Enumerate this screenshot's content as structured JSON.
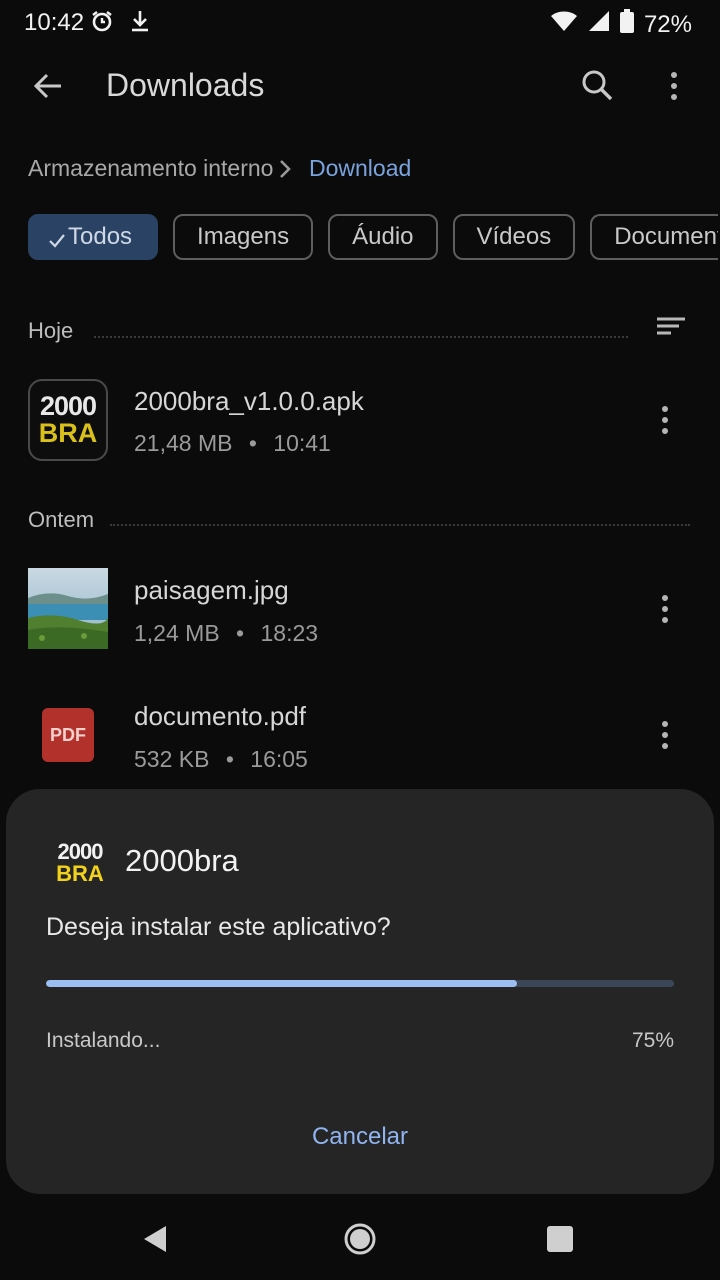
{
  "status": {
    "time": "10:42",
    "battery": "72%"
  },
  "appbar": {
    "title": "Downloads"
  },
  "breadcrumb": {
    "root": "Armazenamento interno",
    "current": "Download"
  },
  "chips": [
    {
      "label": "Todos",
      "selected": true
    },
    {
      "label": "Imagens",
      "selected": false
    },
    {
      "label": "Áudio",
      "selected": false
    },
    {
      "label": "Vídeos",
      "selected": false
    },
    {
      "label": "Document",
      "selected": false
    }
  ],
  "sections": [
    {
      "label": "Hoje"
    },
    {
      "label": "Ontem"
    }
  ],
  "files": [
    {
      "name": "2000bra_v1.0.0.apk",
      "size": "21,48 MB",
      "time": "10:41",
      "icon": {
        "line1": "2000",
        "line2": "BRA"
      }
    },
    {
      "name": "paisagem.jpg",
      "size": "1,24 MB",
      "time": "18:23",
      "icon": "image-thumbnail"
    },
    {
      "name": "documento.pdf",
      "size": "532 KB",
      "time": "16:05",
      "icon": {
        "label": "PDF"
      }
    }
  ],
  "dialog": {
    "app_name": "2000bra",
    "logo": {
      "line1": "2000",
      "line2": "BRA"
    },
    "question": "Deseja instalar este aplicativo?",
    "progress": 0.75,
    "status": "Instalando...",
    "percent": "75%",
    "cancel": "Cancelar"
  },
  "colors": {
    "accent": "#8fb4f0",
    "progress_fill": "#9bbff2",
    "progress_track": "#3b4658",
    "logo_yellow": "#f2d21b",
    "pdf_red": "#b3312b"
  }
}
